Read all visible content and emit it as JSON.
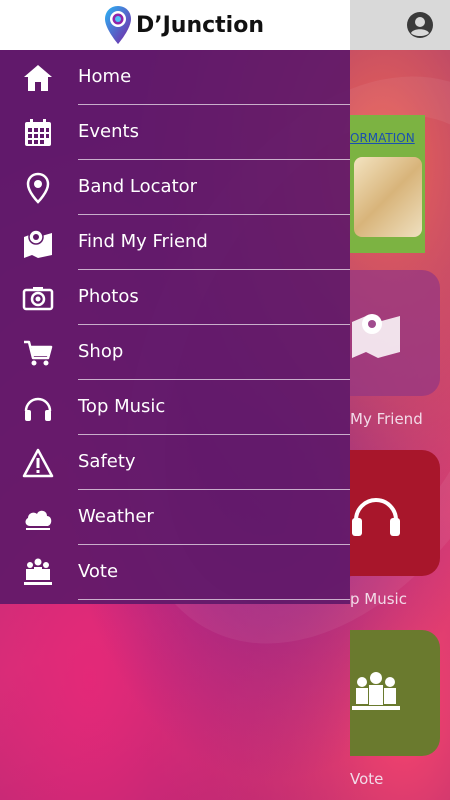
{
  "app": {
    "name": "D’Junction",
    "logo_icon": "location-pin-logo-icon",
    "account_icon": "account-circle-icon"
  },
  "colors": {
    "topbar": "#ffffff",
    "drawer": "#5f1969",
    "divider": "#ffffff"
  },
  "drawer": {
    "items": [
      {
        "label": "Home",
        "icon": "home-icon"
      },
      {
        "label": "Events",
        "icon": "calendar-icon"
      },
      {
        "label": "Band Locator",
        "icon": "map-pin-icon"
      },
      {
        "label": "Find My Friend",
        "icon": "map-marker-icon"
      },
      {
        "label": "Photos",
        "icon": "camera-icon"
      },
      {
        "label": "Shop",
        "icon": "cart-icon"
      },
      {
        "label": "Top Music",
        "icon": "headphones-icon"
      },
      {
        "label": "Safety",
        "icon": "warning-icon"
      },
      {
        "label": "Weather",
        "icon": "cloud-icon"
      },
      {
        "label": "Vote",
        "icon": "vote-icon"
      }
    ]
  },
  "background": {
    "info_link": "ORMATION",
    "tiles": [
      {
        "label": "My Friend",
        "icon": "map-marker-icon"
      },
      {
        "label": "p Music",
        "icon": "headphones-icon"
      },
      {
        "label": "Vote",
        "icon": "vote-icon"
      }
    ]
  }
}
